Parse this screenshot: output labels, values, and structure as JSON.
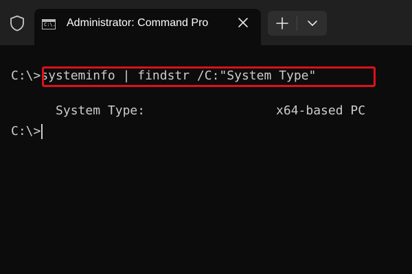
{
  "window": {
    "tab_title": "Administrator: Command Pro",
    "tab_icon_text": "C:\\."
  },
  "terminal": {
    "prompt1": "C:\\>",
    "command": "systeminfo | findstr /C:\"System Type\"",
    "output_label": "System Type:",
    "output_value": "x64-based PC",
    "prompt2": "C:\\>"
  },
  "colors": {
    "background": "#0c0c0c",
    "titlebar": "#202020",
    "text": "#cccccc",
    "highlight_border": "#e0101a"
  },
  "icons": {
    "shield": "shield-icon",
    "close": "close-icon",
    "new_tab": "plus-icon",
    "dropdown": "chevron-down-icon"
  }
}
